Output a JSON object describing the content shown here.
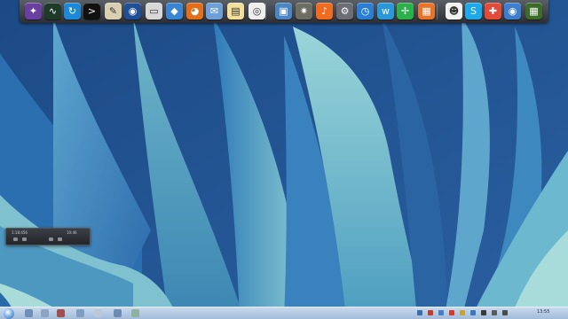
{
  "dock": {
    "icons": [
      {
        "name": "purple-galaxy-icon",
        "color": "#6a3fa0",
        "glyph": "✦"
      },
      {
        "name": "activity-monitor-icon",
        "color": "#1e3b2a",
        "glyph": "∿"
      },
      {
        "name": "sync-icon",
        "color": "#1e88d8",
        "glyph": "↻"
      },
      {
        "name": "terminal-icon",
        "color": "#111111",
        "glyph": ">"
      },
      {
        "name": "text-editor-icon",
        "color": "#d8d0b0",
        "glyph": "✎"
      },
      {
        "name": "disk-utility-icon",
        "color": "#1f4f95",
        "glyph": "◉"
      },
      {
        "name": "hard-drive-icon",
        "color": "#d8d8d8",
        "glyph": "▭"
      },
      {
        "name": "dropbox-icon",
        "color": "#3a86d6",
        "glyph": "◆"
      },
      {
        "name": "firefox-icon",
        "color": "#e46f1a",
        "glyph": "◕"
      },
      {
        "name": "mail-icon",
        "color": "#6f9fd8",
        "glyph": "✉"
      },
      {
        "name": "notes-icon",
        "color": "#f1df9a",
        "glyph": "▤"
      },
      {
        "name": "ipod-icon",
        "color": "#eeeeee",
        "glyph": "◎"
      },
      {
        "name": "preview-icon",
        "color": "#4b86c3",
        "glyph": "▣"
      },
      {
        "name": "star-gear-icon",
        "color": "#6e6d63",
        "glyph": "✷"
      },
      {
        "name": "music-icon",
        "color": "#f06a1f",
        "glyph": "♪"
      },
      {
        "name": "system-preferences-icon",
        "color": "#6b6f75",
        "glyph": "⚙"
      },
      {
        "name": "clock-icon",
        "color": "#2a7fd4",
        "glyph": "◷"
      },
      {
        "name": "w-app-icon",
        "color": "#2a97d8",
        "glyph": "w"
      },
      {
        "name": "network-icon",
        "color": "#2bb14a",
        "glyph": "✢"
      },
      {
        "name": "presentation-icon",
        "color": "#e8732a",
        "glyph": "▦"
      },
      {
        "name": "people-icon",
        "color": "#f2f2f2",
        "glyph": "☻"
      },
      {
        "name": "skype-icon",
        "color": "#1eaae8",
        "glyph": "S"
      },
      {
        "name": "puzzle-icon",
        "color": "#e24a3a",
        "glyph": "✚"
      },
      {
        "name": "chromium-icon",
        "color": "#3d7ed1",
        "glyph": "◉"
      },
      {
        "name": "green-grid-icon",
        "color": "#3d6b2a",
        "glyph": "▦"
      }
    ]
  },
  "media_widget": {
    "time_left": "1:18:456",
    "time_right": "10:46"
  },
  "taskbar": {
    "tray_icons": [
      {
        "name": "tray-volume-icon",
        "color": "#3a6ea8"
      },
      {
        "name": "tray-network-icon",
        "color": "#c23b2b"
      },
      {
        "name": "tray-app-icon",
        "color": "#4a7ec4"
      },
      {
        "name": "tray-shield-icon",
        "color": "#d03a2a"
      },
      {
        "name": "tray-flag-icon",
        "color": "#c9a03a"
      },
      {
        "name": "tray-display-icon",
        "color": "#3a78c0"
      },
      {
        "name": "tray-battery-icon",
        "color": "#3a3a3a"
      },
      {
        "name": "tray-speaker-icon",
        "color": "#5a5a5a"
      },
      {
        "name": "tray-keyboard-icon",
        "color": "#4b4b4b"
      }
    ],
    "clock": "13:55"
  },
  "colors": {
    "wallpaper_dark": "#153e78",
    "wallpaper_mid": "#2a6aa8",
    "wallpaper_light": "#7ec6cf"
  }
}
